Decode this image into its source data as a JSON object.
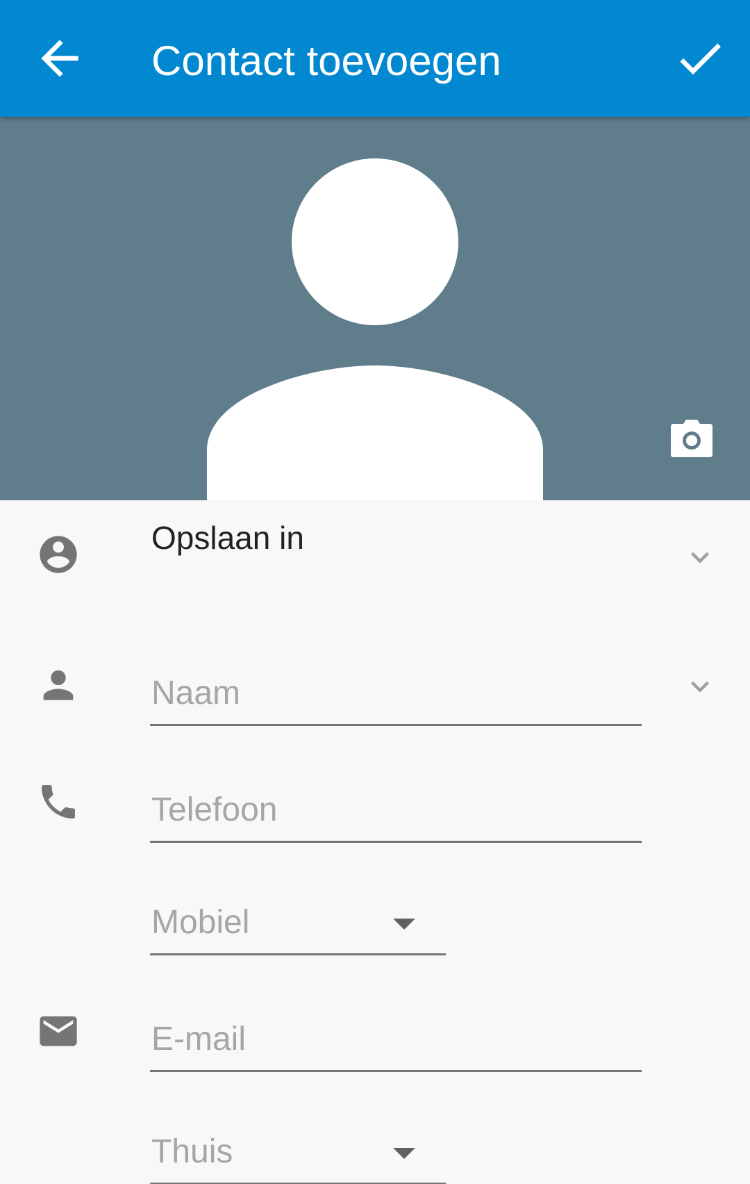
{
  "appbar": {
    "title": "Contact toevoegen",
    "back_icon": "arrow-back-icon",
    "save_icon": "check-icon",
    "background": "#0288d1"
  },
  "photo": {
    "background": "#607d8b",
    "avatar_icon": "person-placeholder-icon",
    "camera_icon": "camera-icon"
  },
  "form": {
    "account": {
      "label": "Opslaan in",
      "icon": "account-circle-icon",
      "expand_icon": "chevron-down-icon"
    },
    "name": {
      "placeholder": "Naam",
      "icon": "person-icon",
      "expand_icon": "chevron-down-icon"
    },
    "phone": {
      "placeholder": "Telefoon",
      "icon": "phone-icon",
      "type_value": "Mobiel"
    },
    "email": {
      "placeholder": "E-mail",
      "icon": "email-icon",
      "type_value": "Thuis"
    }
  }
}
